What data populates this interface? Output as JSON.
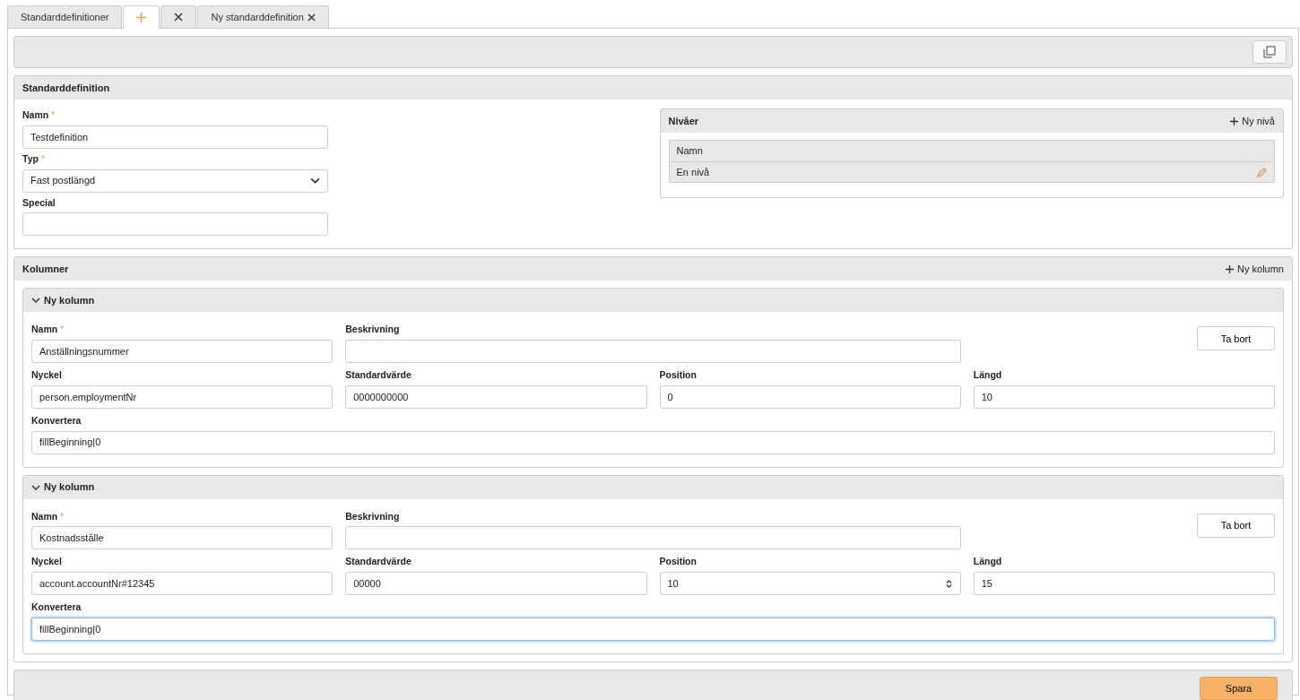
{
  "tabs": [
    {
      "kind": "label",
      "label": "Standarddefinitioner",
      "closable": false,
      "selected": false
    },
    {
      "kind": "add",
      "selected": true
    },
    {
      "kind": "close",
      "selected": false
    },
    {
      "kind": "label",
      "label": "Ny standarddefinition",
      "closable": true,
      "selected": false
    }
  ],
  "definition": {
    "title": "Standarddefinition",
    "fields": [
      {
        "kind": "text",
        "label": "Namn",
        "required_mark": "*",
        "value": "Testdefinition"
      },
      {
        "kind": "select",
        "label": "Typ",
        "required_mark": "*",
        "value": "Fast postlängd"
      },
      {
        "kind": "text",
        "label": "Special"
      }
    ]
  },
  "levels": {
    "title": "Nivåer",
    "add_label": "Ny nivå",
    "header": "Namn",
    "rows": [
      {
        "name": "En nivå"
      }
    ]
  },
  "columns": {
    "title": "Kolumner",
    "add_label": "Ny kolumn",
    "items": [
      {
        "title": "Ny kolumn",
        "expanded": true,
        "remove_label": "Ta bort",
        "fields": [
          {
            "kind": "normal",
            "label": "Namn",
            "required_mark": "*",
            "value": "Anställningsnummer",
            "focused": false,
            "spinner": false
          },
          {
            "kind": "wide",
            "label": "Beskrivning",
            "focused": false,
            "spinner": false
          },
          {
            "kind": "normal",
            "label": "Nyckel",
            "value": "person.employmentNr",
            "focused": false,
            "spinner": false
          },
          {
            "kind": "normal",
            "label": "Standardvärde",
            "value": "0000000000",
            "focused": false,
            "spinner": false
          },
          {
            "kind": "normal",
            "label": "Position",
            "value": "0",
            "focused": false,
            "spinner": false
          },
          {
            "kind": "normal",
            "label": "Längd",
            "value": "10",
            "focused": false,
            "spinner": false
          },
          {
            "kind": "full",
            "label": "Konvertera",
            "value": "fillBeginning|0",
            "focused": false,
            "spinner": false
          }
        ]
      },
      {
        "title": "Ny kolumn",
        "expanded": true,
        "remove_label": "Ta bort",
        "fields": [
          {
            "kind": "normal",
            "label": "Namn",
            "required_mark": "*",
            "value": "Kostnadsställe",
            "focused": false,
            "spinner": false
          },
          {
            "kind": "wide",
            "label": "Beskrivning",
            "focused": false,
            "spinner": false
          },
          {
            "kind": "normal",
            "label": "Nyckel",
            "value": "account.accountNr#12345",
            "focused": false,
            "spinner": false
          },
          {
            "kind": "normal",
            "label": "Standardvärde",
            "value": "00000",
            "focused": false,
            "spinner": false
          },
          {
            "kind": "normal",
            "label": "Position",
            "value": "10",
            "focused": false,
            "spinner": true
          },
          {
            "kind": "normal",
            "label": "Längd",
            "value": "15",
            "focused": false,
            "spinner": false
          },
          {
            "kind": "full",
            "label": "Konvertera",
            "value": "fillBeginning|0",
            "focused": true,
            "spinner": false
          }
        ]
      }
    ]
  },
  "save_label": "Spara"
}
